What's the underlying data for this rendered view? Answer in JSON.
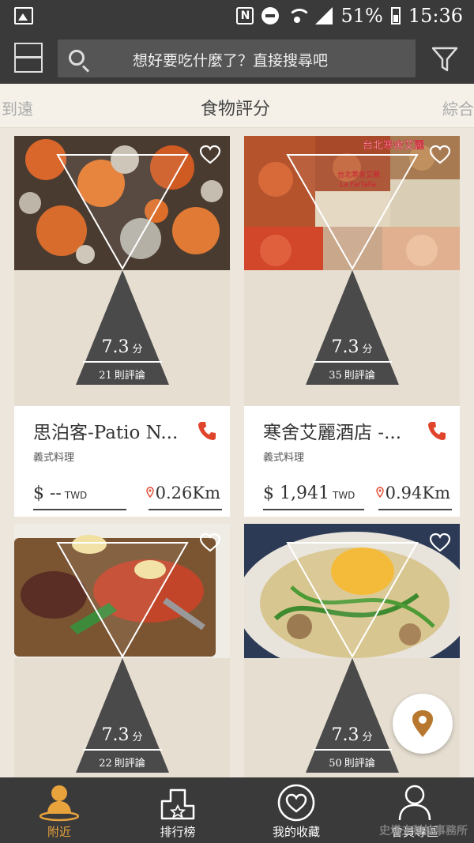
{
  "status_bar": {
    "battery": "51%",
    "time": "15:36"
  },
  "header": {
    "search_placeholder": "想好要吃什麼了？直接搜尋吧"
  },
  "tabs": {
    "left": "到遠",
    "center": "食物評分",
    "right": "綜合"
  },
  "cards": [
    {
      "name": "思泊客-Patio N...",
      "cuisine": "義式料理",
      "score": "7.3",
      "score_unit": "分",
      "review_count": "21",
      "review_label": "則評論",
      "price": "$ --",
      "currency": "TWD",
      "distance": "0.26Km"
    },
    {
      "name": "寒舍艾麗酒店 -...",
      "cuisine": "義式料理",
      "score": "7.3",
      "score_unit": "分",
      "review_count": "35",
      "review_label": "則評論",
      "price": "$ 1,941",
      "currency": "TWD",
      "distance": "0.94Km",
      "photo_text": "台北寒舍艾麗",
      "photo_subtext": "台北寒舍艾麗",
      "photo_subtext2": "La Farfalla"
    },
    {
      "score": "7.3",
      "score_unit": "分",
      "review_count": "22",
      "review_label": "則評論"
    },
    {
      "score": "7.3",
      "score_unit": "分",
      "review_count": "50",
      "review_label": "則評論"
    }
  ],
  "bottom_nav": {
    "items": [
      {
        "label": "附近",
        "icon": "nearby-person-icon",
        "active": true
      },
      {
        "label": "排行榜",
        "icon": "ranking-podium-icon"
      },
      {
        "label": "我的收藏",
        "icon": "heart-favorites-icon"
      },
      {
        "label": "會員專區",
        "icon": "member-person-icon"
      }
    ]
  },
  "watermark": "史塔夫科技事務所",
  "colors": {
    "bar": "#3a3a3a",
    "accent": "#e8a33d",
    "phone_icon": "#e0452c",
    "card_bg": "#e6dfd1",
    "triangle": "#4a4a4a"
  }
}
